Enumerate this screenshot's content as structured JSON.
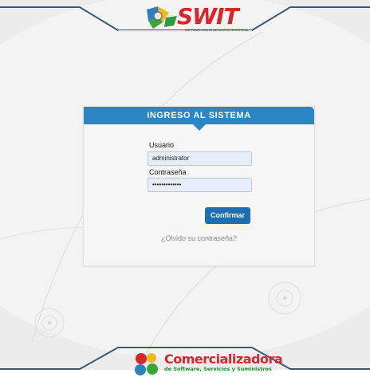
{
  "header": {
    "logo_text": "SWIT",
    "logo_tagline": "SOFTWARE WEB DE IMPUESTOS TERRITORIALES"
  },
  "login": {
    "title": "INGRESO AL SISTEMA",
    "username_label": "Usuario",
    "username_value": "administrator",
    "password_label": "Contraseña",
    "password_value": "•••••••••••••",
    "confirm_label": "Confirmar",
    "forgot_link": "¿Olvido su contraseña?"
  },
  "footer": {
    "company_name": "Comercializadora",
    "company_sub": "de Software, Servicios y Suministros"
  },
  "colors": {
    "accent": "#2b87c4",
    "button": "#1c6fb2",
    "brand_red": "#d8262e",
    "brand_green": "#1e8c2a",
    "background": "#ececec"
  }
}
